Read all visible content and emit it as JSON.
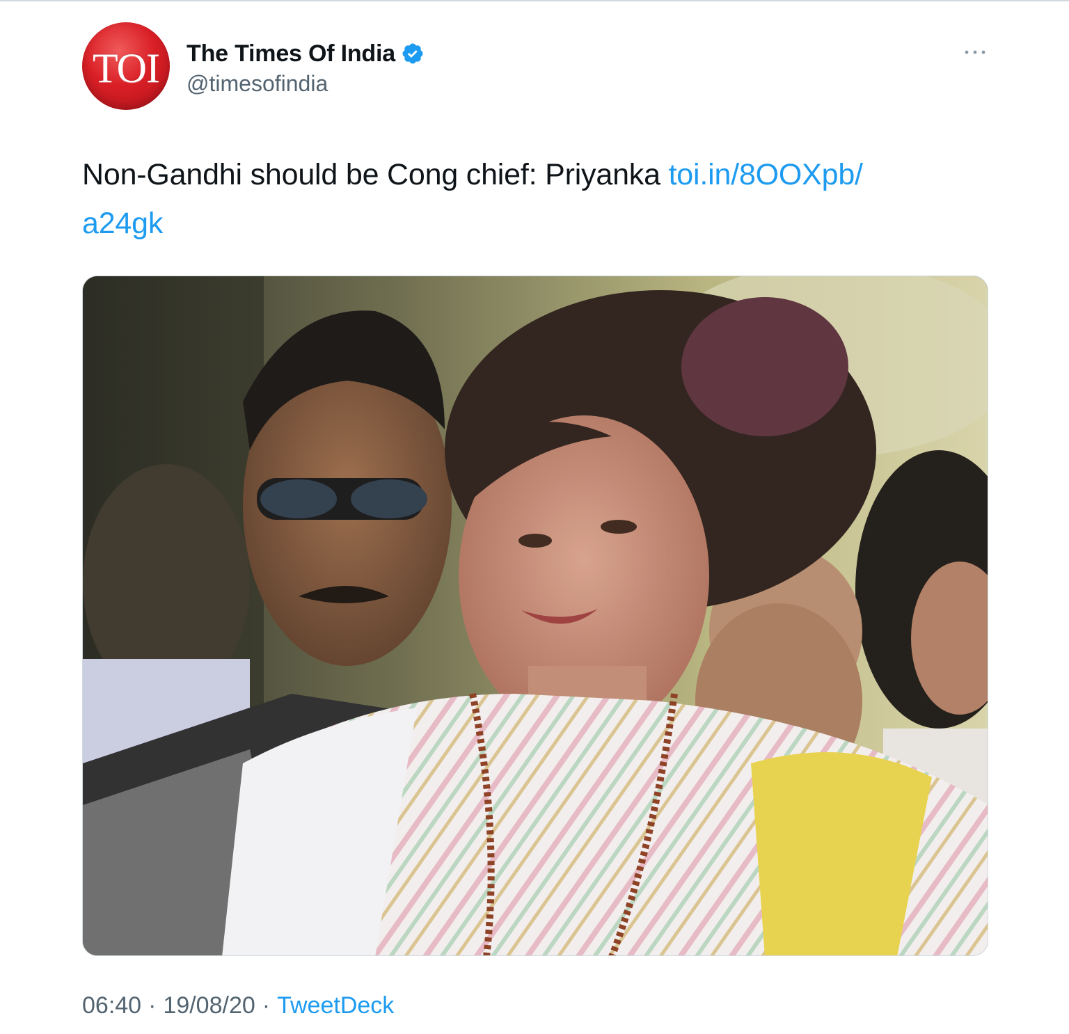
{
  "author": {
    "avatar_text": "TOI",
    "display_name": "The Times Of India",
    "handle": "@timesofindia",
    "verified": true
  },
  "menu": {
    "more_icon": "more-horizontal-icon"
  },
  "tweet": {
    "text": "Non-Gandhi should be Cong chief: Priyanka",
    "link_line1": "toi.in/8OOXpb/",
    "link_line2": "a24gk"
  },
  "media": {
    "alt": "Photo of Priyanka Gandhi in a striped saree with a man in sunglasses behind her"
  },
  "footer": {
    "time": "06:40",
    "separator": "·",
    "date": "19/08/20",
    "source": "TweetDeck"
  },
  "colors": {
    "link": "#1d9bf0",
    "secondary_text": "#536471",
    "primary_text": "#0f1419",
    "avatar_red": "#d91f26"
  }
}
